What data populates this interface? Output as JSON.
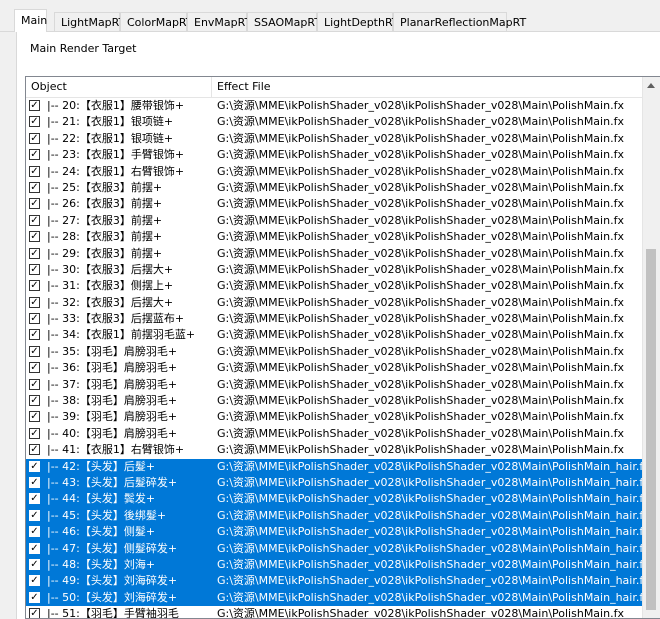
{
  "tabs": [
    {
      "label": "Main",
      "active": true
    },
    {
      "label": "LightMapRT",
      "active": false
    },
    {
      "label": "ColorMapRT",
      "active": false
    },
    {
      "label": "EnvMapRT",
      "active": false
    },
    {
      "label": "SSAOMapRT",
      "active": false
    },
    {
      "label": "LightDepthRT",
      "active": false
    },
    {
      "label": "PlanarReflectionMapRT",
      "active": false
    }
  ],
  "section_label": "Main Render Target",
  "columns": {
    "object": "Object",
    "effect": "Effect File"
  },
  "colors": {
    "selection": "#0078d7"
  },
  "rows": [
    {
      "object": "|-- 20:【衣服1】腰带银饰+",
      "effect": "G:\\资源\\MME\\ikPolishShader_v028\\ikPolishShader_v028\\Main\\PolishMain.fx",
      "checked": true,
      "selected": false
    },
    {
      "object": "|-- 21:【衣服1】银项链+",
      "effect": "G:\\资源\\MME\\ikPolishShader_v028\\ikPolishShader_v028\\Main\\PolishMain.fx",
      "checked": true,
      "selected": false
    },
    {
      "object": "|-- 22:【衣服1】银项链+",
      "effect": "G:\\资源\\MME\\ikPolishShader_v028\\ikPolishShader_v028\\Main\\PolishMain.fx",
      "checked": true,
      "selected": false
    },
    {
      "object": "|-- 23:【衣服1】手臂银饰+",
      "effect": "G:\\资源\\MME\\ikPolishShader_v028\\ikPolishShader_v028\\Main\\PolishMain.fx",
      "checked": true,
      "selected": false
    },
    {
      "object": "|-- 24:【衣服1】右臂银饰+",
      "effect": "G:\\资源\\MME\\ikPolishShader_v028\\ikPolishShader_v028\\Main\\PolishMain.fx",
      "checked": true,
      "selected": false
    },
    {
      "object": "|-- 25:【衣服3】前摆+",
      "effect": "G:\\资源\\MME\\ikPolishShader_v028\\ikPolishShader_v028\\Main\\PolishMain.fx",
      "checked": true,
      "selected": false
    },
    {
      "object": "|-- 26:【衣服3】前摆+",
      "effect": "G:\\资源\\MME\\ikPolishShader_v028\\ikPolishShader_v028\\Main\\PolishMain.fx",
      "checked": true,
      "selected": false
    },
    {
      "object": "|-- 27:【衣服3】前摆+",
      "effect": "G:\\资源\\MME\\ikPolishShader_v028\\ikPolishShader_v028\\Main\\PolishMain.fx",
      "checked": true,
      "selected": false
    },
    {
      "object": "|-- 28:【衣服3】前摆+",
      "effect": "G:\\资源\\MME\\ikPolishShader_v028\\ikPolishShader_v028\\Main\\PolishMain.fx",
      "checked": true,
      "selected": false
    },
    {
      "object": "|-- 29:【衣服3】前摆+",
      "effect": "G:\\资源\\MME\\ikPolishShader_v028\\ikPolishShader_v028\\Main\\PolishMain.fx",
      "checked": true,
      "selected": false
    },
    {
      "object": "|-- 30:【衣服3】后摆大+",
      "effect": "G:\\资源\\MME\\ikPolishShader_v028\\ikPolishShader_v028\\Main\\PolishMain.fx",
      "checked": true,
      "selected": false
    },
    {
      "object": "|-- 31:【衣服3】侧摆上+",
      "effect": "G:\\资源\\MME\\ikPolishShader_v028\\ikPolishShader_v028\\Main\\PolishMain.fx",
      "checked": true,
      "selected": false
    },
    {
      "object": "|-- 32:【衣服3】后摆大+",
      "effect": "G:\\资源\\MME\\ikPolishShader_v028\\ikPolishShader_v028\\Main\\PolishMain.fx",
      "checked": true,
      "selected": false
    },
    {
      "object": "|-- 33:【衣服3】后摆蓝布+",
      "effect": "G:\\资源\\MME\\ikPolishShader_v028\\ikPolishShader_v028\\Main\\PolishMain.fx",
      "checked": true,
      "selected": false
    },
    {
      "object": "|-- 34:【衣服1】前摆羽毛蓝+",
      "effect": "G:\\资源\\MME\\ikPolishShader_v028\\ikPolishShader_v028\\Main\\PolishMain.fx",
      "checked": true,
      "selected": false
    },
    {
      "object": "|-- 35:【羽毛】肩膀羽毛+",
      "effect": "G:\\资源\\MME\\ikPolishShader_v028\\ikPolishShader_v028\\Main\\PolishMain.fx",
      "checked": true,
      "selected": false
    },
    {
      "object": "|-- 36:【羽毛】肩膀羽毛+",
      "effect": "G:\\资源\\MME\\ikPolishShader_v028\\ikPolishShader_v028\\Main\\PolishMain.fx",
      "checked": true,
      "selected": false
    },
    {
      "object": "|-- 37:【羽毛】肩膀羽毛+",
      "effect": "G:\\资源\\MME\\ikPolishShader_v028\\ikPolishShader_v028\\Main\\PolishMain.fx",
      "checked": true,
      "selected": false
    },
    {
      "object": "|-- 38:【羽毛】肩膀羽毛+",
      "effect": "G:\\资源\\MME\\ikPolishShader_v028\\ikPolishShader_v028\\Main\\PolishMain.fx",
      "checked": true,
      "selected": false
    },
    {
      "object": "|-- 39:【羽毛】肩膀羽毛+",
      "effect": "G:\\资源\\MME\\ikPolishShader_v028\\ikPolishShader_v028\\Main\\PolishMain.fx",
      "checked": true,
      "selected": false
    },
    {
      "object": "|-- 40:【羽毛】肩膀羽毛+",
      "effect": "G:\\资源\\MME\\ikPolishShader_v028\\ikPolishShader_v028\\Main\\PolishMain.fx",
      "checked": true,
      "selected": false
    },
    {
      "object": "|-- 41:【衣服1】右臂银饰+",
      "effect": "G:\\资源\\MME\\ikPolishShader_v028\\ikPolishShader_v028\\Main\\PolishMain.fx",
      "checked": true,
      "selected": false
    },
    {
      "object": "|-- 42:【头发】后髮+",
      "effect": "G:\\资源\\MME\\ikPolishShader_v028\\ikPolishShader_v028\\Main\\PolishMain_hair.fx",
      "checked": true,
      "selected": true
    },
    {
      "object": "|-- 43:【头发】后髮碎发+",
      "effect": "G:\\资源\\MME\\ikPolishShader_v028\\ikPolishShader_v028\\Main\\PolishMain_hair.fx",
      "checked": true,
      "selected": true
    },
    {
      "object": "|-- 44:【头发】鬓发+",
      "effect": "G:\\资源\\MME\\ikPolishShader_v028\\ikPolishShader_v028\\Main\\PolishMain_hair.fx",
      "checked": true,
      "selected": true
    },
    {
      "object": "|-- 45:【头发】後绑髮+",
      "effect": "G:\\资源\\MME\\ikPolishShader_v028\\ikPolishShader_v028\\Main\\PolishMain_hair.fx",
      "checked": true,
      "selected": true
    },
    {
      "object": "|-- 46:【头发】侧髮+",
      "effect": "G:\\资源\\MME\\ikPolishShader_v028\\ikPolishShader_v028\\Main\\PolishMain_hair.fx",
      "checked": true,
      "selected": true
    },
    {
      "object": "|-- 47:【头发】侧髮碎发+",
      "effect": "G:\\资源\\MME\\ikPolishShader_v028\\ikPolishShader_v028\\Main\\PolishMain_hair.fx",
      "checked": true,
      "selected": true
    },
    {
      "object": "|-- 48:【头发】刘海+",
      "effect": "G:\\资源\\MME\\ikPolishShader_v028\\ikPolishShader_v028\\Main\\PolishMain_hair.fx",
      "checked": true,
      "selected": true
    },
    {
      "object": "|-- 49:【头发】刘海碎发+",
      "effect": "G:\\资源\\MME\\ikPolishShader_v028\\ikPolishShader_v028\\Main\\PolishMain_hair.fx",
      "checked": true,
      "selected": true
    },
    {
      "object": "|-- 50:【头发】刘海碎发+",
      "effect": "G:\\资源\\MME\\ikPolishShader_v028\\ikPolishShader_v028\\Main\\PolishMain_hair.fx",
      "checked": true,
      "selected": true
    },
    {
      "object": "|-- 51:【羽毛】手臂袖羽毛",
      "effect": "G:\\资源\\MME\\ikPolishShader_v028\\ikPolishShader_v028\\Main\\PolishMain.fx",
      "checked": true,
      "selected": false
    }
  ]
}
